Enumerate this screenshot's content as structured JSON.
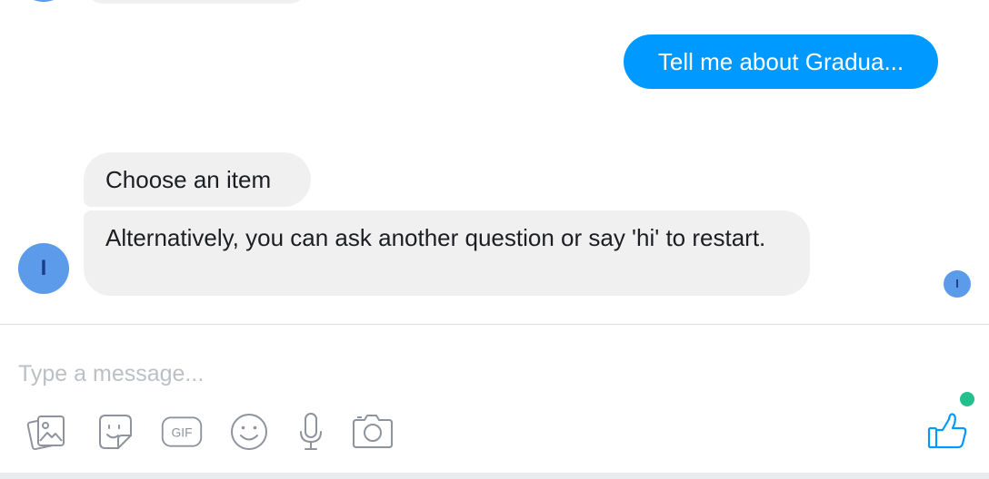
{
  "conversation": {
    "outgoing": [
      {
        "text": "Tell me about Gradua..."
      }
    ],
    "incoming": [
      {
        "text": "Choose an item"
      },
      {
        "text": "Alternatively, you can ask another question or say 'hi' to restart."
      }
    ],
    "bot_avatar_initial": "I",
    "read_receipt_initial": "I"
  },
  "composer": {
    "placeholder": "Type a message...",
    "value": "",
    "gif_label": "GIF",
    "tools": [
      "photo-icon",
      "sticker-icon",
      "gif-icon",
      "emoji-icon",
      "microphone-icon",
      "camera-icon"
    ],
    "like_icon": "thumbs-up-icon"
  },
  "colors": {
    "accent": "#0099ff",
    "incoming_bubble": "#f0f0f0",
    "avatar": "#5b9bea",
    "online_status": "#21c08d",
    "icon_gray": "#8d949e"
  }
}
